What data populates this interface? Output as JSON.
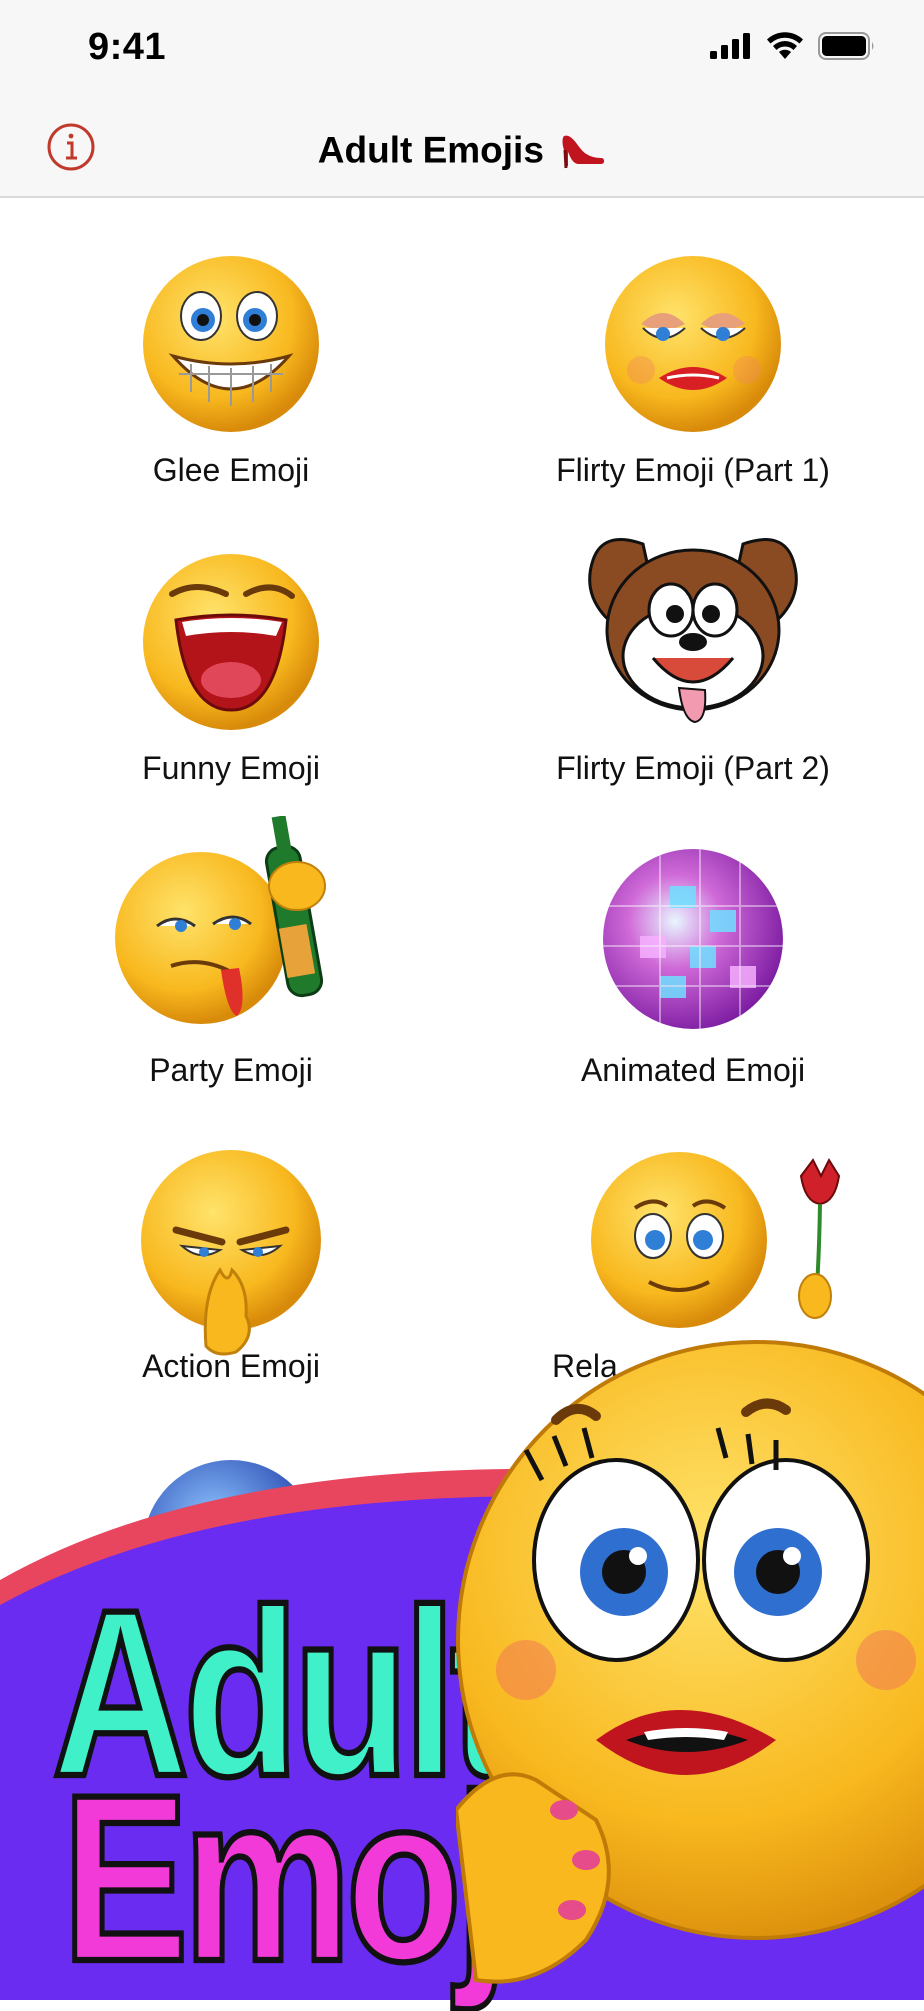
{
  "status_bar": {
    "time": "9:41"
  },
  "nav": {
    "title": "Adult Emojis"
  },
  "categories": [
    {
      "label": "Glee Emoji"
    },
    {
      "label": "Flirty Emoji (Part 1)"
    },
    {
      "label": "Funny Emoji"
    },
    {
      "label": "Flirty Emoji (Part 2)"
    },
    {
      "label": "Party Emoji"
    },
    {
      "label": "Animated Emoji"
    },
    {
      "label": "Action Emoji"
    },
    {
      "label": "Rela"
    }
  ],
  "banner": {
    "line1": "Adult",
    "line2": "Emoji"
  },
  "colors": {
    "accent": "#c0392b",
    "banner_purple": "#6a2cf0",
    "banner_pink": "#e8465f",
    "text_teal": "#3ff0c8",
    "text_magenta": "#f23ad8"
  },
  "icons": [
    "info-icon",
    "high-heel-icon",
    "signal-icon",
    "wifi-icon",
    "battery-icon"
  ]
}
